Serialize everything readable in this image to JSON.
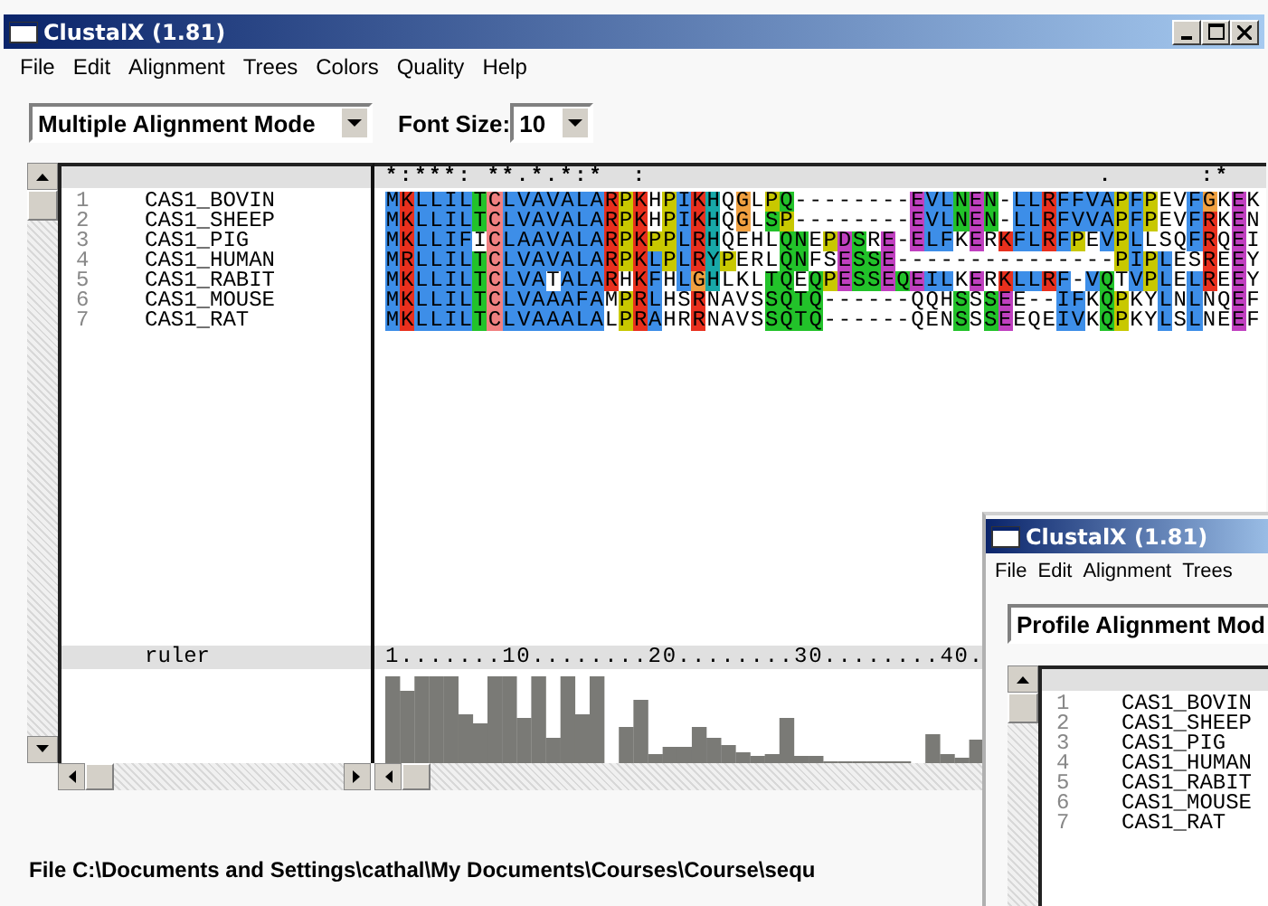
{
  "window": {
    "title": "ClustalX (1.81)"
  },
  "menu": [
    "File",
    "Edit",
    "Alignment",
    "Trees",
    "Colors",
    "Quality",
    "Help"
  ],
  "toolbar": {
    "mode": "Multiple Alignment Mode",
    "font_size_label": "Font Size:",
    "font_size": "10"
  },
  "alignment": {
    "conservation": "*:***: **.*.*:*  :                               .      :*",
    "sequences": [
      {
        "number": "1",
        "name": "CAS1_BOVIN",
        "residues": "MKLLILTCLVAVALARPKHPIKHQGLPQ--------EVLNEN-LLRFFVAPFPEVFGKEK"
      },
      {
        "number": "2",
        "name": "CAS1_SHEEP",
        "residues": "MKLLILTCLVAVALARPKHPIKHQGLSP--------EVLNEN-LLRFVVAPFPEVFRKEN"
      },
      {
        "number": "3",
        "name": "CAS1_PIG",
        "residues": "MKLLIFICLAAVALARPKPPLRHQEHLQNEPDSRE-ELFKERKFLRFPEVPLLSQFRQEI"
      },
      {
        "number": "4",
        "name": "CAS1_HUMAN",
        "residues": "MRLLILTCLVAVALARPKLPLRYPERLQNFSESSE---------------PIPLESREEY"
      },
      {
        "number": "5",
        "name": "CAS1_RABIT",
        "residues": "MKLLILTCLVATALARHKFHLGHLKLTQEQPESSEQEILKERKLLRF-VQTVPLELREEY"
      },
      {
        "number": "6",
        "name": "CAS1_MOUSE",
        "residues": "MKLLILTCLVAAAFAMPRLHSRNAVSSQTQ------QQHSSSEE--IFKQPKYLNLNQEF"
      },
      {
        "number": "7",
        "name": "CAS1_RAT",
        "residues": "MKLLILTCLVAAALALPRAHRRNAVSSQTQ------QENSSSEEQEIVKQPKYLSLNEEF"
      }
    ],
    "ruler_label": "ruler",
    "ruler": "1.......10........20........30........40."
  },
  "status": "File C:\\Documents and Settings\\cathal\\My Documents\\Courses\\Course\\sequ",
  "profile_window": {
    "title": "ClustalX (1.81)",
    "menu": [
      "File",
      "Edit",
      "Alignment",
      "Trees"
    ],
    "mode": "Profile Alignment Mod",
    "sequences": [
      {
        "number": "1",
        "name": "CAS1_BOVIN"
      },
      {
        "number": "2",
        "name": "CAS1_SHEEP"
      },
      {
        "number": "3",
        "name": "CAS1_PIG"
      },
      {
        "number": "4",
        "name": "CAS1_HUMAN"
      },
      {
        "number": "5",
        "name": "CAS1_RABIT"
      },
      {
        "number": "6",
        "name": "CAS1_MOUSE"
      },
      {
        "number": "7",
        "name": "CAS1_RAT"
      }
    ]
  }
}
